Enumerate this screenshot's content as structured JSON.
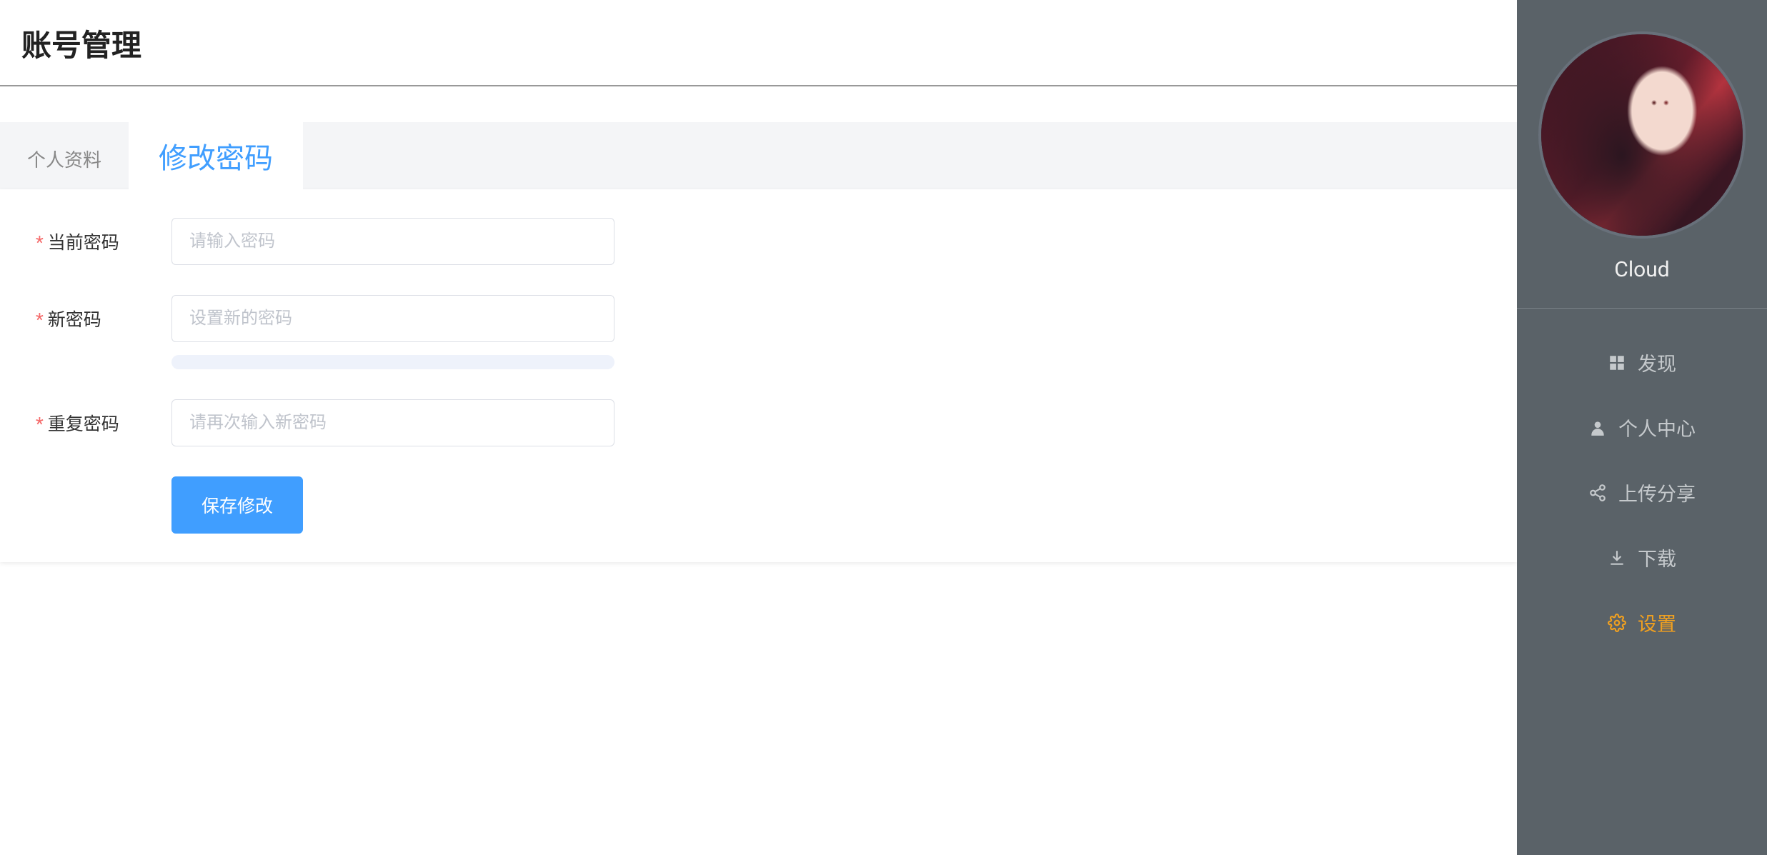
{
  "header": {
    "title": "账号管理"
  },
  "tabs": {
    "profile": "个人资料",
    "change_password": "修改密码"
  },
  "form": {
    "current_password": {
      "label": "当前密码",
      "placeholder": "请输入密码"
    },
    "new_password": {
      "label": "新密码",
      "placeholder": "设置新的密码"
    },
    "repeat_password": {
      "label": "重复密码",
      "placeholder": "请再次输入新密码"
    },
    "required_mark": "*",
    "save_button": "保存修改"
  },
  "sidebar": {
    "username": "Cloud",
    "nav": {
      "discover": "发现",
      "personal": "个人中心",
      "upload": "上传分享",
      "download": "下载",
      "settings": "设置"
    }
  }
}
